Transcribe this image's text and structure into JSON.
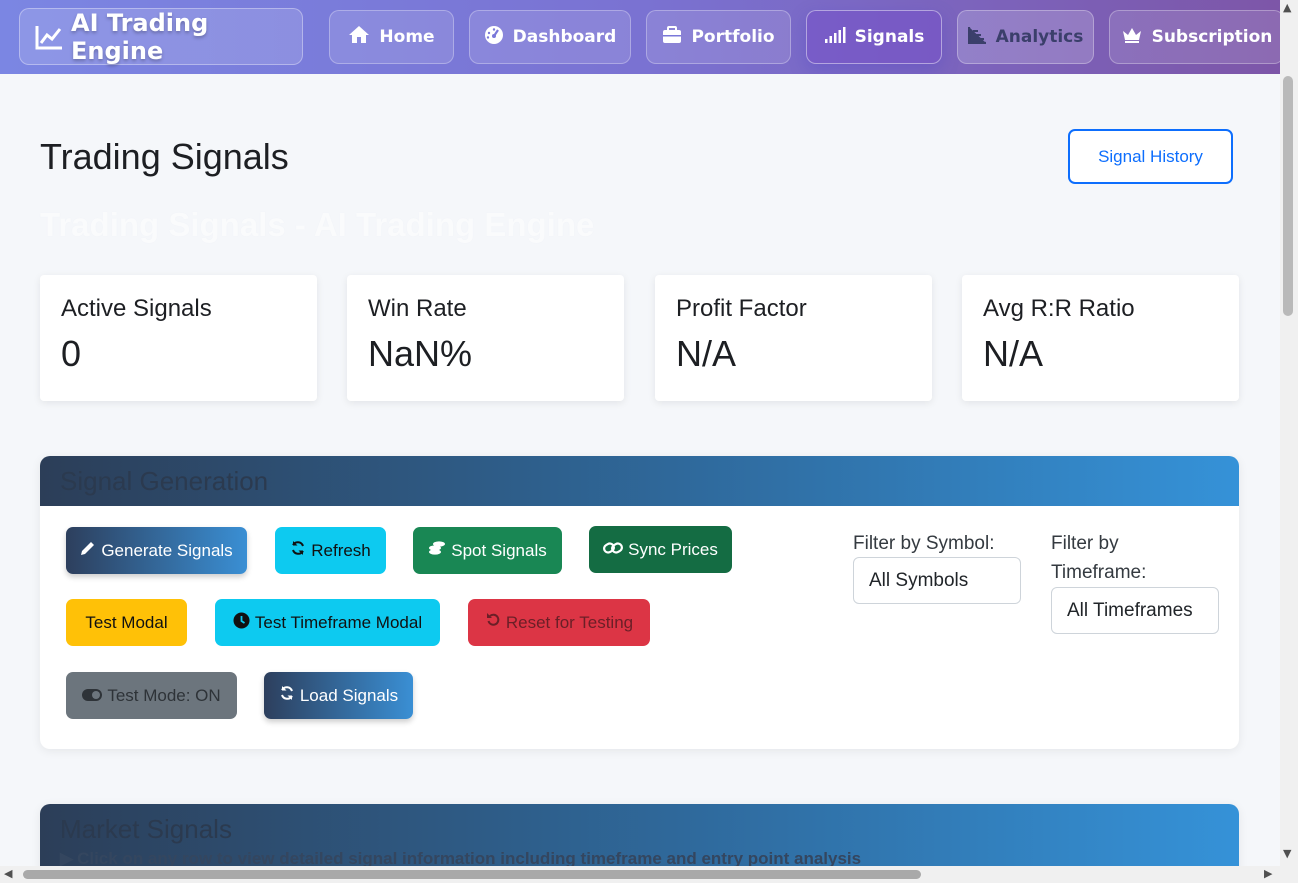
{
  "nav": {
    "brand": "AI Trading Engine",
    "items": [
      {
        "label": "Home",
        "icon": "home-icon"
      },
      {
        "label": "Dashboard",
        "icon": "speedometer-icon"
      },
      {
        "label": "Portfolio",
        "icon": "briefcase-icon"
      },
      {
        "label": "Signals",
        "icon": "signal-bars-icon",
        "active": true
      },
      {
        "label": "Analytics",
        "icon": "area-chart-icon"
      },
      {
        "label": "Subscription",
        "icon": "crown-icon"
      }
    ]
  },
  "header": {
    "title": "Trading Signals",
    "ghost_title": "Trading Signals - AI Trading Engine",
    "history_button": "Signal History"
  },
  "stats": [
    {
      "label": "Active Signals",
      "value": "0"
    },
    {
      "label": "Win Rate",
      "value": "NaN%"
    },
    {
      "label": "Profit Factor",
      "value": "N/A"
    },
    {
      "label": "Avg R:R Ratio",
      "value": "N/A"
    }
  ],
  "signal_generation": {
    "title": "Signal Generation",
    "buttons": {
      "generate": "Generate Signals",
      "refresh": "Refresh",
      "spot": "Spot Signals",
      "sync": "Sync Prices",
      "test_modal": "Test Modal",
      "test_timeframe": "Test Timeframe Modal",
      "reset": "Reset for Testing",
      "test_mode": "Test Mode: ON",
      "load": "Load Signals"
    },
    "filter_symbol_label": "Filter by Symbol:",
    "filter_symbol_value": "All Symbols",
    "filter_timeframe_label": "Filter by Timeframe:",
    "filter_timeframe_value": "All Timeframes"
  },
  "market_signals": {
    "title": "Market Signals",
    "hint": "Click on any row to view detailed signal information including timeframe and entry point analysis"
  },
  "colors": {
    "primary": "#0d6efd",
    "nav_gradient_start": "#7b86e3",
    "nav_gradient_end": "#7d56a8",
    "info": "#0dcaf0",
    "success": "#198754",
    "warning": "#ffc107",
    "danger": "#dc3545",
    "secondary": "#6c757d"
  }
}
